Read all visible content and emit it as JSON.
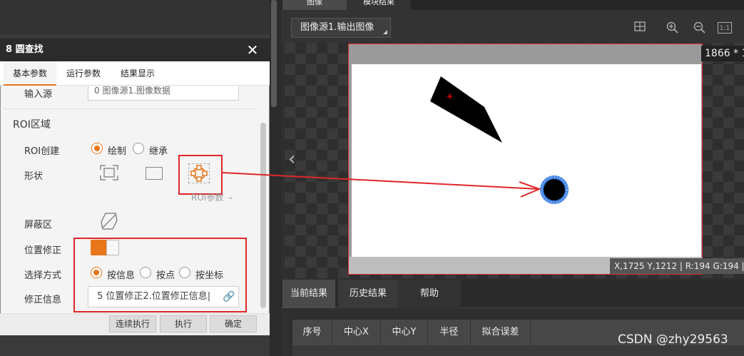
{
  "app": {
    "top_tabs": [
      "图像",
      "模块结果"
    ],
    "image_source": "图像源1.输出图像",
    "resolution": "1866 * 1",
    "coords": "X,1725  Y,1212  |  R:194  G:194  |",
    "result_tabs": [
      "当前结果",
      "历史结果",
      "帮助"
    ],
    "table_headers": [
      "序号",
      "中心X",
      "中心Y",
      "半径",
      "拟合误差"
    ],
    "watermark": "CSDN @zhy29563",
    "toolbar_icons": [
      "fit-screen-icon",
      "zoom-in-icon",
      "zoom-out-icon",
      "actual-size-icon"
    ],
    "actual_size_label": "1:1"
  },
  "dialog": {
    "title": "8 圆查找",
    "tabs": [
      "基本参数",
      "运行参数",
      "结果显示"
    ],
    "input_source_label": "输入源",
    "input_source_value": "0 图像源1.图像数据",
    "roi_section": "ROI区域",
    "roi_create_label": "ROI创建",
    "roi_create_options": [
      "绘制",
      "继承"
    ],
    "roi_create_selected": "绘制",
    "shape_label": "形状",
    "roi_params_label": "ROI参数",
    "mask_label": "屏蔽区",
    "position_fix_label": "位置修正",
    "position_fix_on": true,
    "select_mode_label": "选择方式",
    "select_mode_options": [
      "按信息",
      "按点",
      "按坐标"
    ],
    "select_mode_selected": "按信息",
    "fix_info_label": "修正信息",
    "fix_info_value": "5 位置修正2.位置修正信息|",
    "buttons": [
      "连续执行",
      "执行",
      "确定"
    ]
  },
  "colors": {
    "accent": "#e8761a",
    "highlight_red": "#e0262a",
    "dark_bg": "#2b2b2b"
  }
}
